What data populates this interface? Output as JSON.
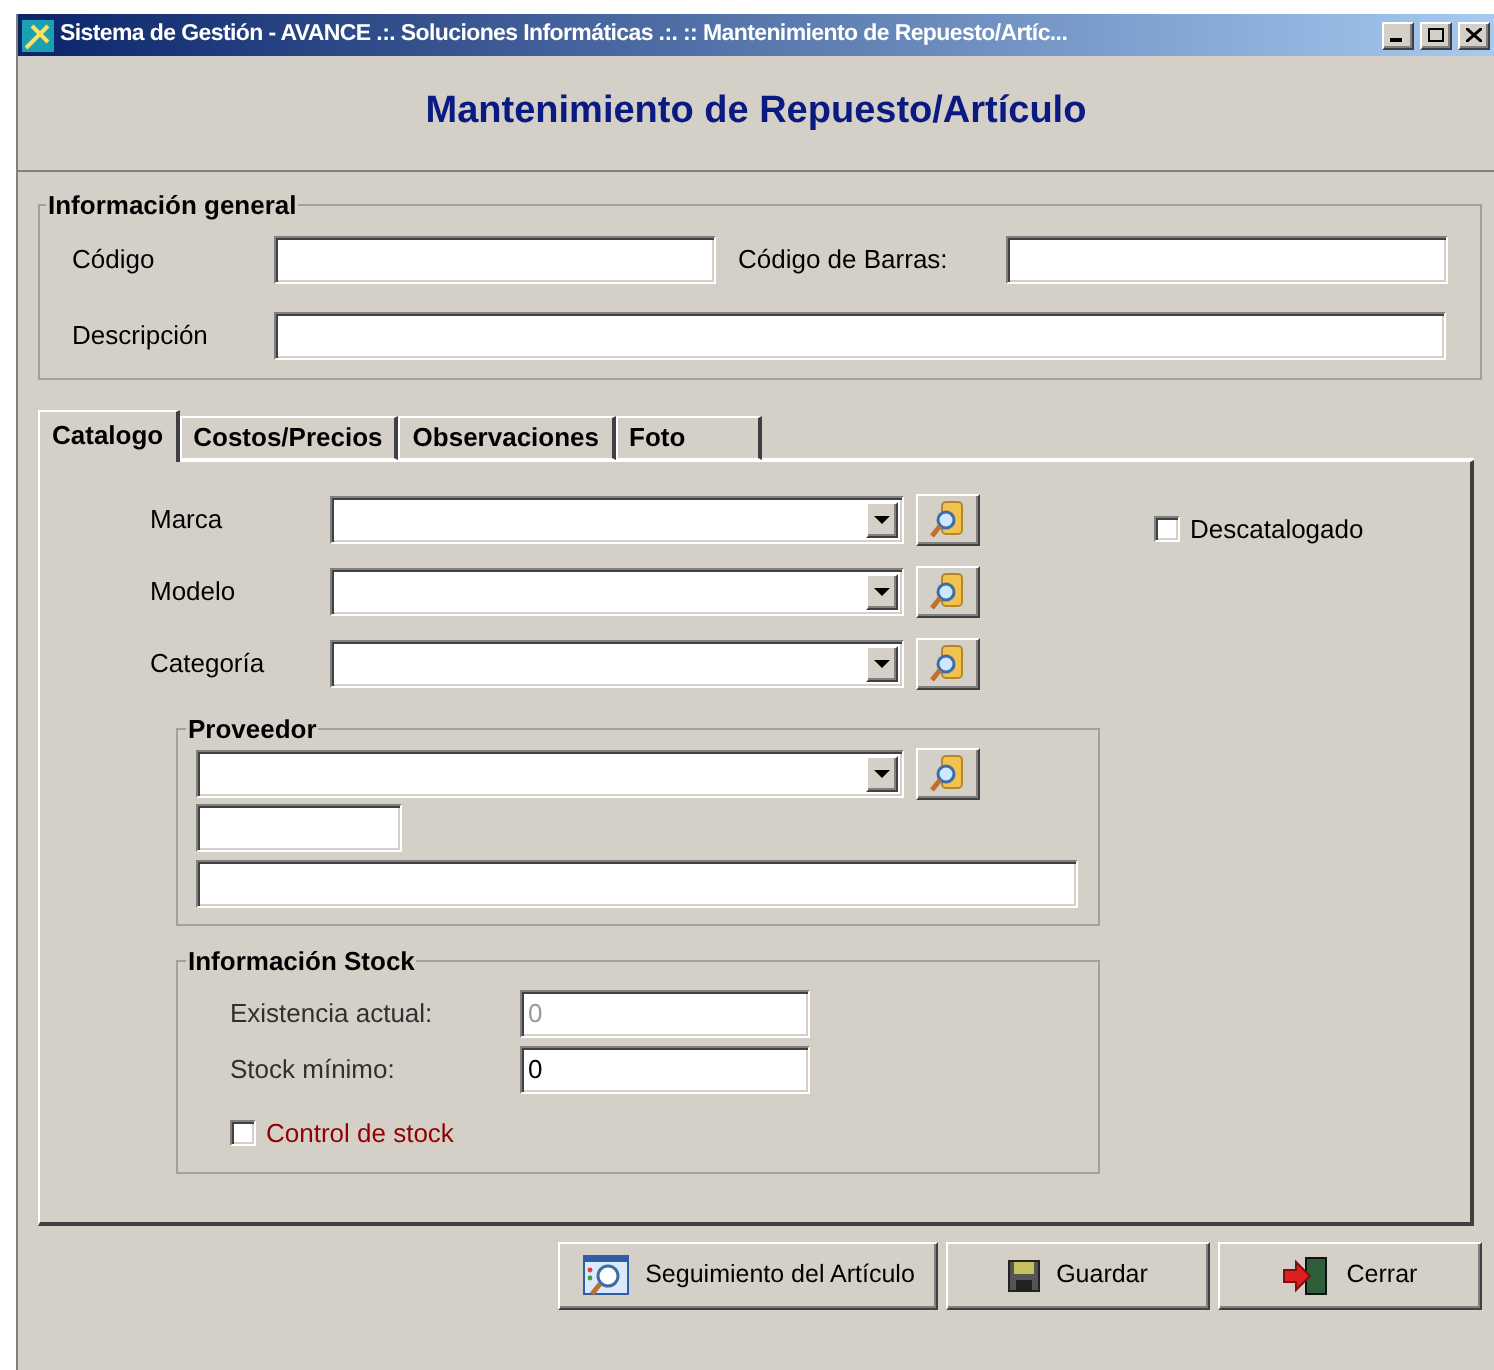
{
  "window": {
    "title": "Sistema de Gestión - AVANCE .:. Soluciones Informáticas .:. :: Mantenimiento de Repuesto/Artíc..."
  },
  "header": {
    "title": "Mantenimiento de Repuesto/Artículo"
  },
  "general_info": {
    "legend": "Información general",
    "code_label": "Código",
    "barcode_label": "Código de Barras:",
    "description_label": "Descripción"
  },
  "tabs": [
    {
      "label": "Catalogo",
      "selected": true
    },
    {
      "label": "Costos/Precios",
      "selected": false
    },
    {
      "label": "Observaciones",
      "selected": false
    },
    {
      "label": "Foto",
      "selected": false
    }
  ],
  "catalog": {
    "lookups": [
      {
        "label": "Marca"
      },
      {
        "label": "Modelo"
      },
      {
        "label": "Categoría"
      }
    ],
    "discontinued": {
      "label": "Descatalogado",
      "checked": false
    },
    "supplier": {
      "legend": "Proveedor"
    },
    "stock": {
      "legend": "Información Stock",
      "fields": [
        {
          "label": "Existencia actual:",
          "value": "0",
          "disabled": true
        },
        {
          "label": "Stock mínimo:",
          "value": "0",
          "disabled": false
        }
      ],
      "stock_control": {
        "label": "Control de stock",
        "checked": false
      }
    }
  },
  "buttons": [
    {
      "kind": "track",
      "label": "Seguimiento del Artículo"
    },
    {
      "kind": "save",
      "label": "Guardar"
    },
    {
      "kind": "close",
      "label": "Cerrar"
    }
  ]
}
